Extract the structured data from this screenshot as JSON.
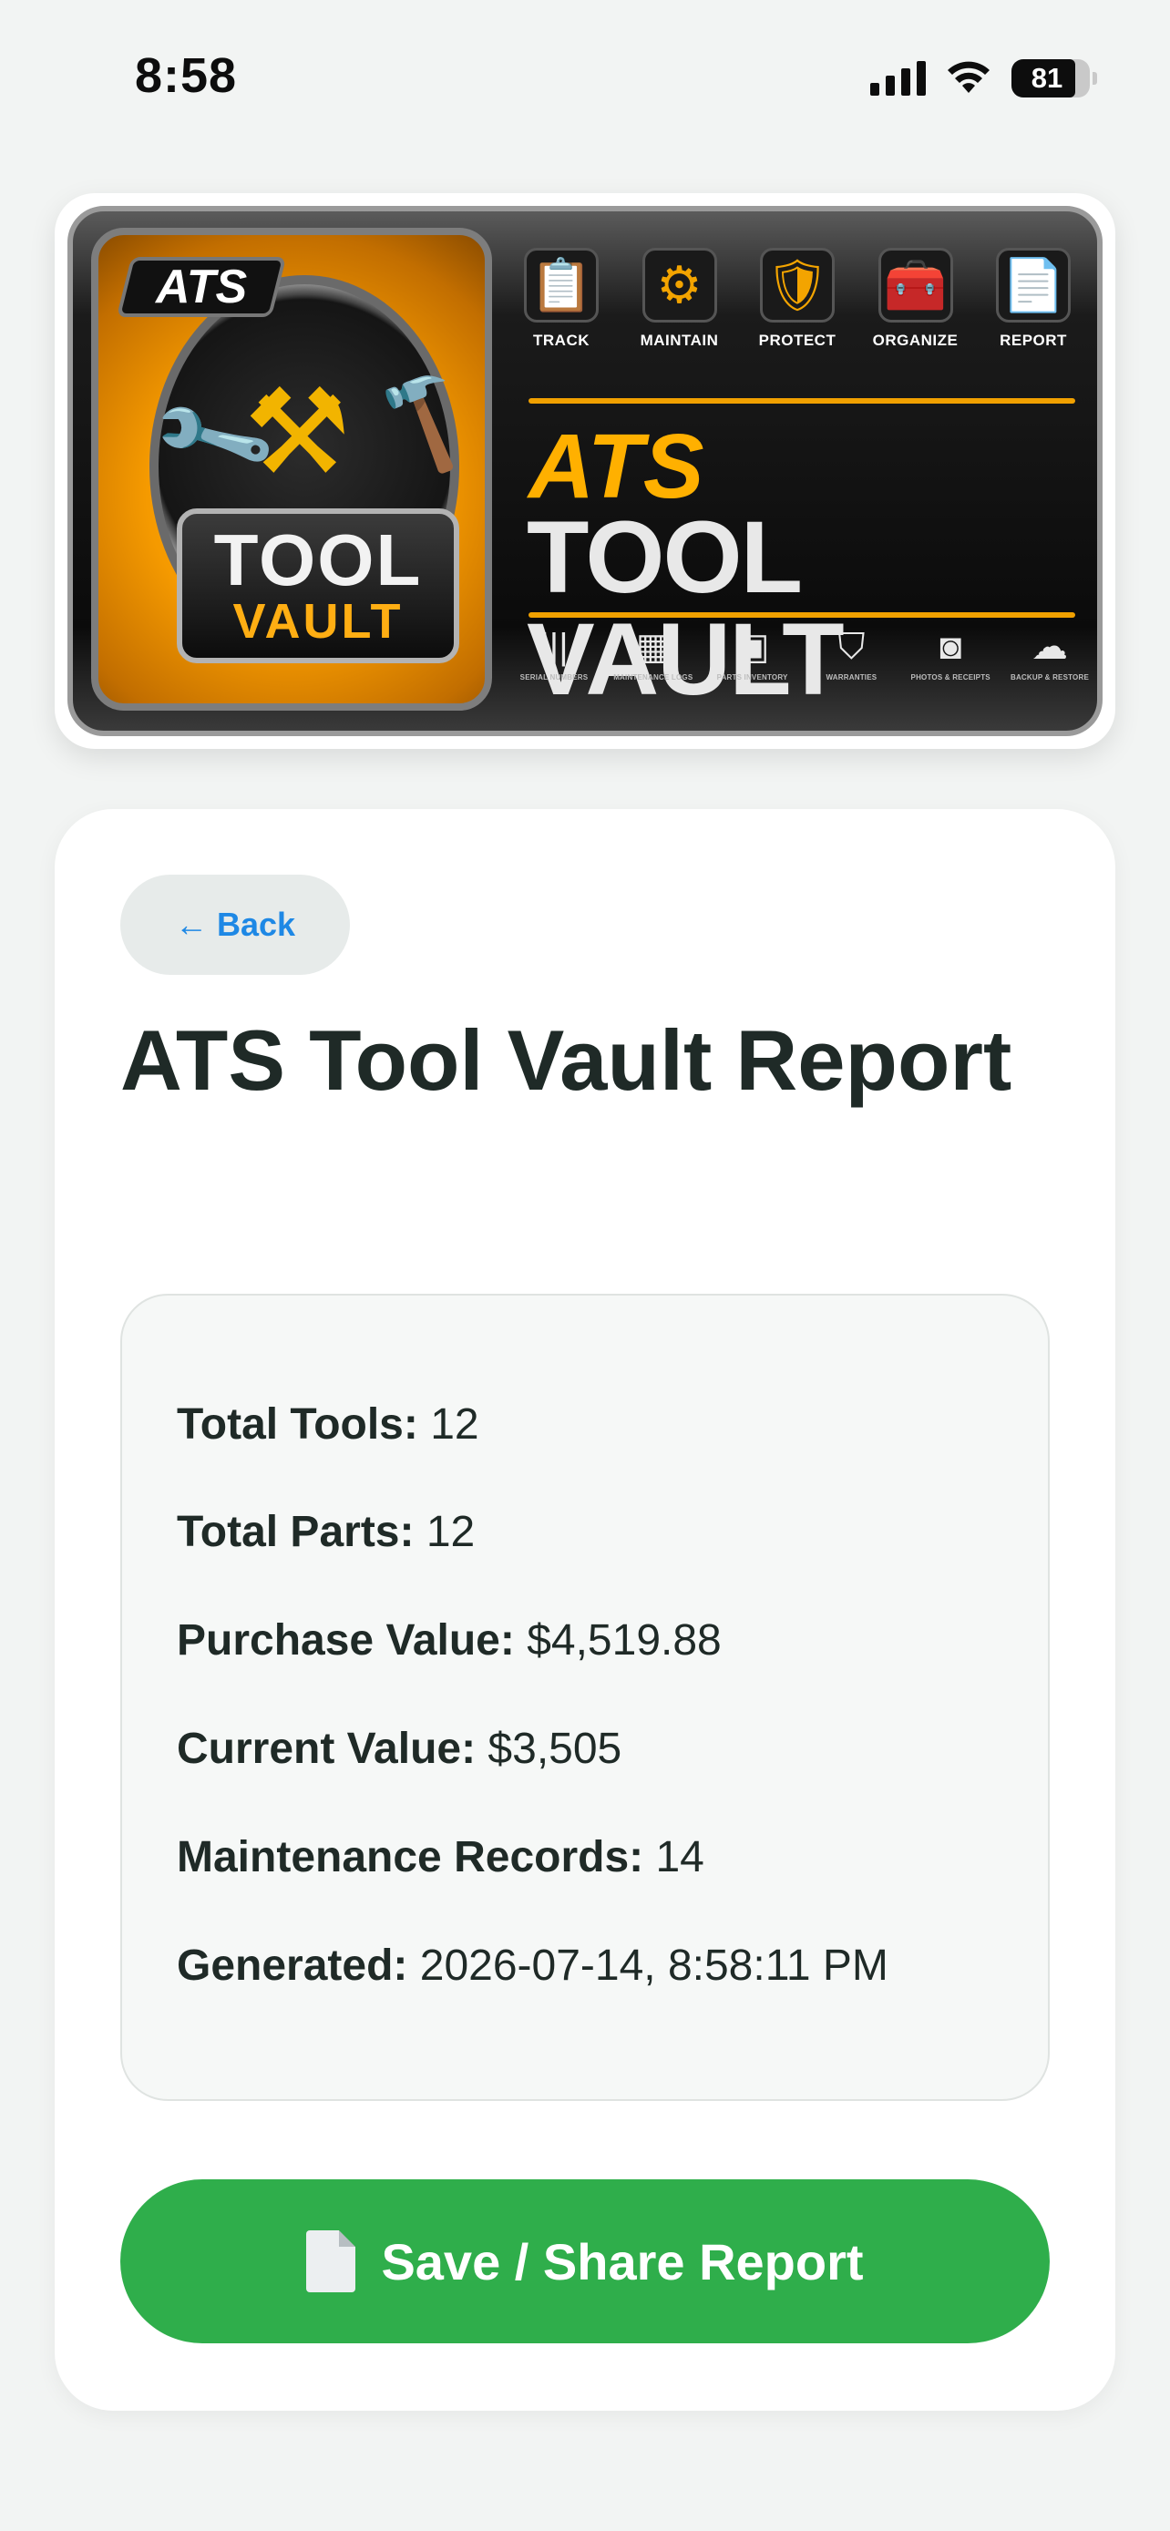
{
  "status_bar": {
    "time": "8:58",
    "battery_level": "81",
    "battery_fraction": 0.81
  },
  "banner": {
    "corner_tag": "ATS",
    "badge_line1": "TOOL",
    "badge_line2": "VAULT",
    "features": [
      {
        "label": "TRACK",
        "icon": "clipboard-icon"
      },
      {
        "label": "MAINTAIN",
        "icon": "gear-wrench-icon"
      },
      {
        "label": "PROTECT",
        "icon": "shield-check-icon"
      },
      {
        "label": "ORGANIZE",
        "icon": "toolbox-icon"
      },
      {
        "label": "REPORT",
        "icon": "report-chart-icon"
      }
    ],
    "title_top": "ATS",
    "title_bottom": "TOOL VAULT",
    "bottom_features": [
      {
        "label": "SERIAL NUMBERS",
        "icon": "barcode-icon"
      },
      {
        "label": "MAINTENANCE LOGS",
        "icon": "calendar-icon"
      },
      {
        "label": "PARTS INVENTORY",
        "icon": "box-icon"
      },
      {
        "label": "WARRANTIES",
        "icon": "shield-icon"
      },
      {
        "label": "PHOTOS & RECEIPTS",
        "icon": "camera-icon"
      },
      {
        "label": "BACKUP & RESTORE",
        "icon": "cloud-upload-icon"
      }
    ],
    "colors": {
      "accent_orange": "#f59a00",
      "panel_dark": "#0b0b0b"
    }
  },
  "main": {
    "back_label": "← Back",
    "title": "ATS Tool Vault Report",
    "stats": [
      {
        "label": "Total Tools:",
        "value": "12"
      },
      {
        "label": "Total Parts:",
        "value": "12"
      },
      {
        "label": "Purchase Value:",
        "value": "$4,519.88"
      },
      {
        "label": "Current Value:",
        "value": "$3,505"
      },
      {
        "label": "Maintenance Records:",
        "value": "14"
      },
      {
        "label": "Generated:",
        "value": "2026-07-14, 8:58:11 PM"
      }
    ],
    "save_label": "Save / Share Report",
    "colors": {
      "link_blue": "#1e88e5",
      "save_green": "#2fae4b"
    }
  }
}
